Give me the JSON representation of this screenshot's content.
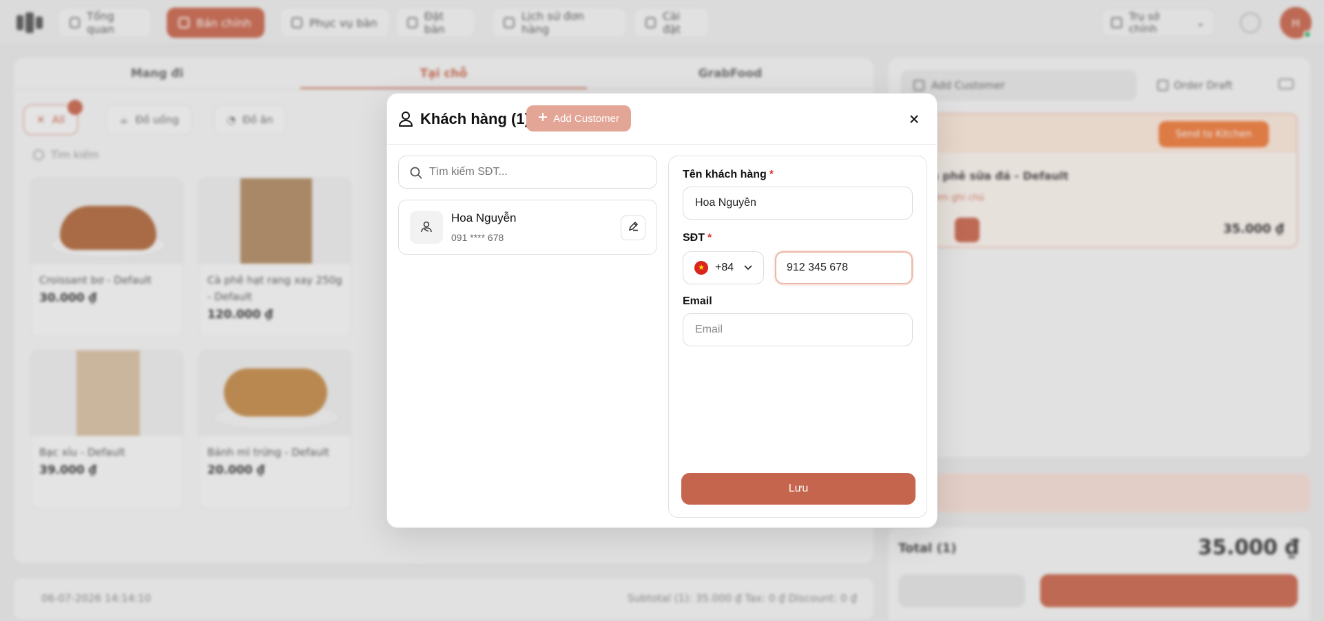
{
  "nav": {
    "tabs": [
      {
        "label": "Tổng quan"
      },
      {
        "label": "Bán chính"
      },
      {
        "label": "Phục vụ bàn"
      },
      {
        "label": "Đặt bàn"
      },
      {
        "label": "Lịch sử đơn hàng"
      },
      {
        "label": "Cài đặt"
      }
    ],
    "store": "Trụ sở chính",
    "avatar_initials": "H"
  },
  "order_tabs": [
    "Mang đi",
    "Tại chỗ",
    "GrabFood"
  ],
  "categories": [
    "All",
    "Đồ uống",
    "Đồ ăn"
  ],
  "bg_search_placeholder": "Tìm kiếm",
  "products": [
    {
      "name": "Croissant bơ - Default",
      "price": "30.000 ₫"
    },
    {
      "name": "Cà phê hạt rang xay 250g - Default",
      "price": "120.000 ₫"
    },
    {
      "name": "Bạc xỉu - Default",
      "price": "39.000 ₫"
    },
    {
      "name": "Bánh mì trứng - Default",
      "price": "20.000 ₫"
    }
  ],
  "order": {
    "add_customer": "Add Customer",
    "order_draft": "Order Draft",
    "send_kitchen": "Send to Kitchen",
    "item_name": "Cà phê sữa đá - Default",
    "item_note": "Thêm ghi chú",
    "item_price": "35.000 ₫",
    "total_label": "Total (1)",
    "total_amount": "35.000 ₫"
  },
  "footer": {
    "datetime": "06-07-2026 14:14:10",
    "summary": "Subtotal (1):  35.000 ₫    Tax:  0 ₫    Discount:  0 ₫"
  },
  "modal": {
    "title": "Khách hàng (1)",
    "add_customer_label": "Add Customer",
    "search_placeholder": "Tìm kiếm SĐT...",
    "customers": [
      {
        "name": "Hoa Nguyễn",
        "phone": "091 **** 678"
      }
    ],
    "form": {
      "name_label": "Tên khách hàng",
      "name_value": "Hoa Nguyễn",
      "phone_label": "SĐT",
      "country_code": "+84",
      "phone_value": "912 345 678",
      "email_label": "Email",
      "email_placeholder": "Email",
      "required_mark": "*",
      "save_label": "Lưu"
    }
  },
  "colors": {
    "accent": "#c6654d",
    "accent_light": "#e3a596",
    "required": "#d9362b",
    "focus_border": "#eab9a8"
  }
}
